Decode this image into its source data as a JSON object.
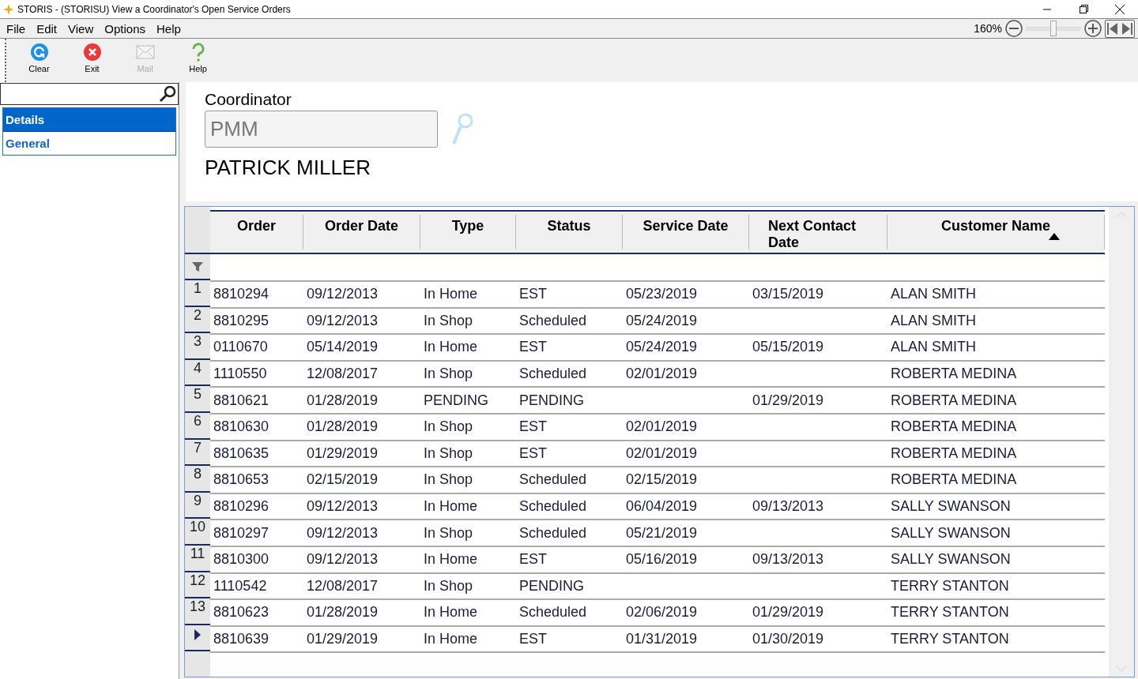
{
  "window": {
    "title": "STORIS - (STORISU) View a Coordinator's Open Service Orders"
  },
  "menu": [
    "File",
    "Edit",
    "View",
    "Options",
    "Help"
  ],
  "zoom": {
    "reading": "160%",
    "level": 0.5
  },
  "toolbar": [
    {
      "label": "Clear",
      "kind": "clear",
      "disabled": false
    },
    {
      "label": "Exit",
      "kind": "exit",
      "disabled": false
    },
    {
      "label": "Mail",
      "kind": "mail",
      "disabled": true
    },
    {
      "label": "Help",
      "kind": "help",
      "disabled": false
    }
  ],
  "sidebar": {
    "items": [
      {
        "label": "Details",
        "selected": true
      },
      {
        "label": "General",
        "selected": false
      }
    ]
  },
  "coordinator": {
    "label": "Coordinator",
    "value": "PMM",
    "name": "PATRICK MILLER"
  },
  "table": {
    "columns": [
      {
        "label": "Order",
        "sorted": false
      },
      {
        "label": "Order Date",
        "sorted": false
      },
      {
        "label": "Type",
        "sorted": false
      },
      {
        "label": "Status",
        "sorted": false
      },
      {
        "label": "Service Date",
        "sorted": false
      },
      {
        "label": "Next Contact Date",
        "sorted": false
      },
      {
        "label": "Customer Name",
        "sorted": true
      }
    ],
    "rows": [
      {
        "number": "1",
        "current": false,
        "cells": [
          "8810294",
          "09/12/2013",
          "In Home",
          "EST",
          "05/23/2019",
          "03/15/2019",
          "ALAN SMITH"
        ]
      },
      {
        "number": "2",
        "current": false,
        "cells": [
          "8810295",
          "09/12/2013",
          "In Shop",
          "Scheduled",
          "05/24/2019",
          "",
          "ALAN SMITH"
        ]
      },
      {
        "number": "3",
        "current": false,
        "cells": [
          "0110670",
          "05/14/2019",
          "In Home",
          "EST",
          "05/24/2019",
          "05/15/2019",
          "ALAN SMITH"
        ]
      },
      {
        "number": "4",
        "current": false,
        "cells": [
          "1110550",
          "12/08/2017",
          "In Shop",
          "Scheduled",
          "02/01/2019",
          "",
          "ROBERTA MEDINA"
        ]
      },
      {
        "number": "5",
        "current": false,
        "cells": [
          "8810621",
          "01/28/2019",
          "PENDING",
          "PENDING",
          "",
          "01/29/2019",
          "ROBERTA MEDINA"
        ]
      },
      {
        "number": "6",
        "current": false,
        "cells": [
          "8810630",
          "01/28/2019",
          "In Shop",
          "EST",
          "02/01/2019",
          "",
          "ROBERTA MEDINA"
        ]
      },
      {
        "number": "7",
        "current": false,
        "cells": [
          "8810635",
          "01/29/2019",
          "In Shop",
          "EST",
          "02/01/2019",
          "",
          "ROBERTA MEDINA"
        ]
      },
      {
        "number": "8",
        "current": false,
        "cells": [
          "8810653",
          "02/15/2019",
          "In Shop",
          "Scheduled",
          "02/15/2019",
          "",
          "ROBERTA MEDINA"
        ]
      },
      {
        "number": "9",
        "current": false,
        "cells": [
          "8810296",
          "09/12/2013",
          "In Home",
          "Scheduled",
          "06/04/2019",
          "09/13/2013",
          "SALLY SWANSON"
        ]
      },
      {
        "number": "10",
        "current": false,
        "cells": [
          "8810297",
          "09/12/2013",
          "In Shop",
          "Scheduled",
          "05/21/2019",
          "",
          "SALLY SWANSON"
        ]
      },
      {
        "number": "11",
        "current": false,
        "cells": [
          "8810300",
          "09/12/2013",
          "In Home",
          "EST",
          "05/16/2019",
          "09/13/2013",
          "SALLY SWANSON"
        ]
      },
      {
        "number": "12",
        "current": false,
        "cells": [
          "1110542",
          "12/08/2017",
          "In Shop",
          "PENDING",
          "",
          "",
          "TERRY STANTON"
        ]
      },
      {
        "number": "13",
        "current": false,
        "cells": [
          "8810623",
          "01/28/2019",
          "In Home",
          "Scheduled",
          "02/06/2019",
          "01/29/2019",
          "TERRY STANTON"
        ]
      },
      {
        "current": true,
        "cells": [
          "8810639",
          "01/29/2019",
          "In Home",
          "EST",
          "01/31/2019",
          "01/30/2019",
          "TERRY STANTON"
        ]
      }
    ]
  }
}
